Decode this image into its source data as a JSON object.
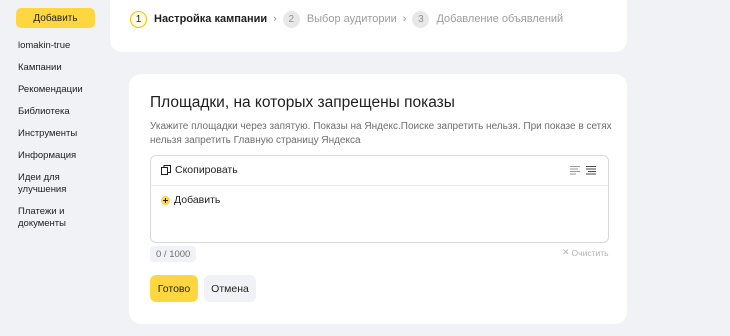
{
  "sidebar": {
    "add_label": "Добавить",
    "items": [
      {
        "label": "lomakin-true"
      },
      {
        "label": "Кампании"
      },
      {
        "label": "Рекомендации"
      },
      {
        "label": "Библиотека"
      },
      {
        "label": "Инструменты"
      },
      {
        "label": "Информация"
      },
      {
        "label": "Идеи для улучшения"
      },
      {
        "label": "Платежи и документы"
      }
    ]
  },
  "stepper": {
    "steps": [
      {
        "num": "1",
        "label": "Настройка кампании",
        "state": "active"
      },
      {
        "num": "2",
        "label": "Выбор аудитории",
        "state": "inactive"
      },
      {
        "num": "3",
        "label": "Добавление объявлений",
        "state": "inactive"
      }
    ]
  },
  "main": {
    "title": "Площадки, на которых запрещены показы",
    "description": "Укажите площадки через запятую. Показы на Яндекс.Поиске запретить нельзя. При показе в сетях нельзя запретить Главную страницу Яндекса",
    "editor": {
      "copy_label": "Скопировать",
      "add_label": "Добавить"
    },
    "counter": "0 / 1000",
    "clear_label": "Очистить",
    "done_label": "Готово",
    "cancel_label": "Отмена"
  },
  "colors": {
    "accent": "#fed740",
    "background": "#f1f2f5",
    "card": "#ffffff"
  },
  "icons": [
    "copy-icon",
    "list-view-icon",
    "text-view-icon",
    "plus-circle-icon",
    "close-icon",
    "chevron-right-icon"
  ]
}
